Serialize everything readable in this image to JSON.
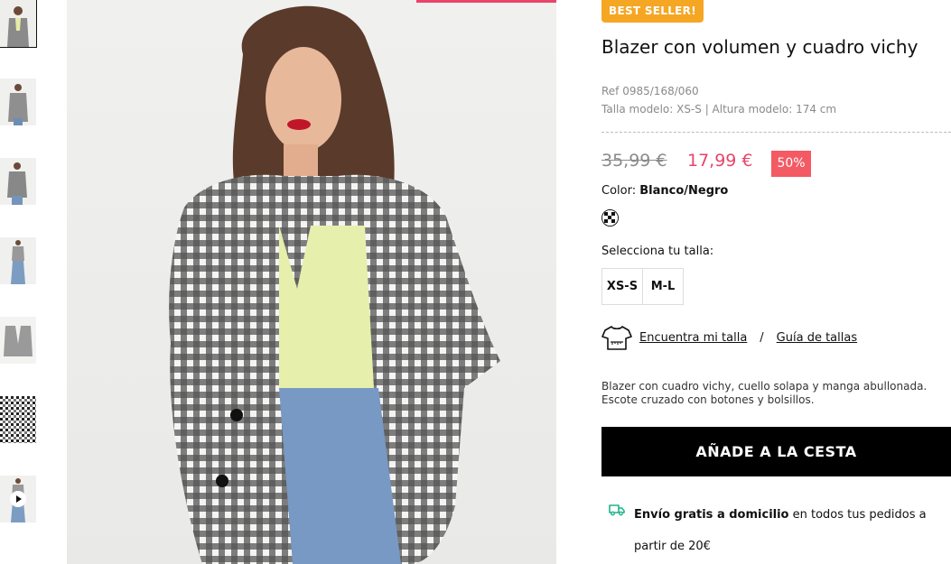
{
  "thumbnails": [
    {
      "name": "thumb-front-full",
      "active": true
    },
    {
      "name": "thumb-front-2",
      "active": false
    },
    {
      "name": "thumb-side",
      "active": false
    },
    {
      "name": "thumb-full-body",
      "active": false
    },
    {
      "name": "thumb-flat-garment",
      "active": false
    },
    {
      "name": "thumb-fabric-detail",
      "active": false
    },
    {
      "name": "thumb-video",
      "active": false
    }
  ],
  "product": {
    "badge": "BEST SELLER!",
    "title": "Blazer con volumen y cuadro vichy",
    "ref": "Ref 0985/168/060",
    "model_info": "Talla modelo: XS-S | Altura modelo: 174 cm",
    "old_price": "35,99 €",
    "new_price": "17,99 €",
    "discount": "50%",
    "color_label": "Color: ",
    "color_value": "Blanco/Negro",
    "size_label": "Selecciona tu talla:",
    "sizes": [
      "XS-S",
      "M-L"
    ],
    "find_size": "Encuentra mi talla",
    "separator": "/",
    "size_guide": "Guía de tallas",
    "description": "Blazer con cuadro vichy, cuello solapa y manga abullonada. Escote cruzado con botones y bolsillos.",
    "add_to_cart": "AÑADE A LA CESTA",
    "shipping_bold": "Envío gratis a domicilio",
    "shipping_rest": " en todos tus pedidos a partir de 20€"
  },
  "colors": {
    "accent_pink": "#e9446a",
    "badge_orange": "#f5a623",
    "discount_red": "#f35a64",
    "shipping_icon": "#1fb38a"
  }
}
